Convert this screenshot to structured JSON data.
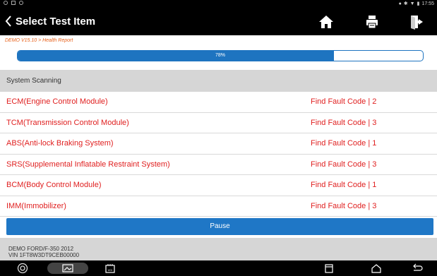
{
  "status_bar": {
    "time": "17:55"
  },
  "header": {
    "title": "Select Test Item",
    "breadcrumb": "DEMO V15.10 > Health Report"
  },
  "progress": {
    "label": "78%",
    "value": 0.78
  },
  "section": {
    "title": "System Scanning"
  },
  "systems": [
    {
      "name": "ECM(Engine Control Module)",
      "status": "Find Fault Code | 2"
    },
    {
      "name": "TCM(Transmission Control Module)",
      "status": "Find Fault Code | 3"
    },
    {
      "name": "ABS(Anti-lock Braking System)",
      "status": "Find Fault Code | 1"
    },
    {
      "name": "SRS(Supplemental Inflatable Restraint System)",
      "status": "Find Fault Code | 3"
    },
    {
      "name": "BCM(Body Control Module)",
      "status": "Find Fault Code | 1"
    },
    {
      "name": "IMM(Immobilizer)",
      "status": "Find Fault Code | 3"
    }
  ],
  "actions": {
    "pause_label": "Pause"
  },
  "vehicle": {
    "model": "DEMO FORD/F-350 2012",
    "vin": "VIN 1FT8W3DT9CEB00000"
  },
  "nav_icons": {
    "vci_label": "VCI"
  },
  "colors": {
    "accent": "#1f77c6",
    "fault_text": "#e02020",
    "breadcrumb": "#e8621c"
  }
}
